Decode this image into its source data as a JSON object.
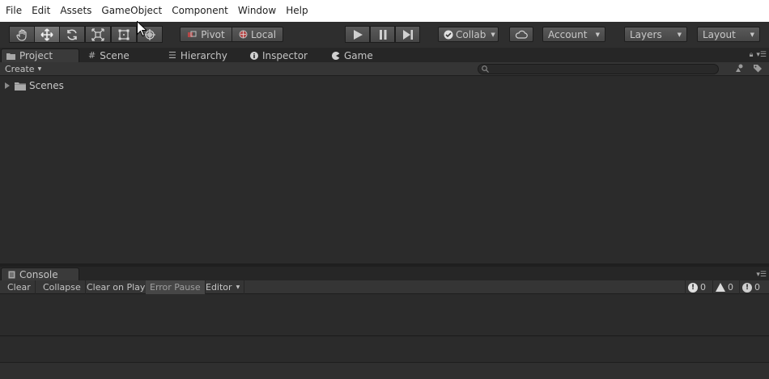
{
  "menu": [
    "File",
    "Edit",
    "Assets",
    "GameObject",
    "Component",
    "Window",
    "Help"
  ],
  "toolbar": {
    "tools": [
      "hand-icon",
      "move-icon",
      "rotate-icon",
      "scale-icon",
      "rect-tool-icon",
      "transform-tool-icon"
    ],
    "active_tool": "move-icon",
    "pivot_label": "Pivot",
    "local_label": "Local",
    "play_controls": [
      "play-icon",
      "pause-icon",
      "step-icon"
    ],
    "collab_label": "Collab",
    "account_label": "Account",
    "layers_label": "Layers",
    "layout_label": "Layout"
  },
  "tabs": [
    {
      "label": "Project",
      "icon": "folder-icon",
      "active": true
    },
    {
      "label": "Scene",
      "icon": "grid-icon"
    },
    {
      "label": "Hierarchy",
      "icon": "list-icon"
    },
    {
      "label": "Inspector",
      "icon": "info-icon"
    },
    {
      "label": "Game",
      "icon": "pacman-icon"
    }
  ],
  "project": {
    "create_label": "Create",
    "search_placeholder": "",
    "tree": [
      {
        "label": "Scenes",
        "icon": "folder-icon",
        "expanded": false
      }
    ]
  },
  "console": {
    "tab_label": "Console",
    "buttons": {
      "clear": "Clear",
      "collapse": "Collapse",
      "clear_on_play": "Clear on Play",
      "error_pause": "Error Pause",
      "editor": "Editor"
    },
    "counts": {
      "errors": "0",
      "warnings": "0",
      "messages": "0"
    }
  }
}
